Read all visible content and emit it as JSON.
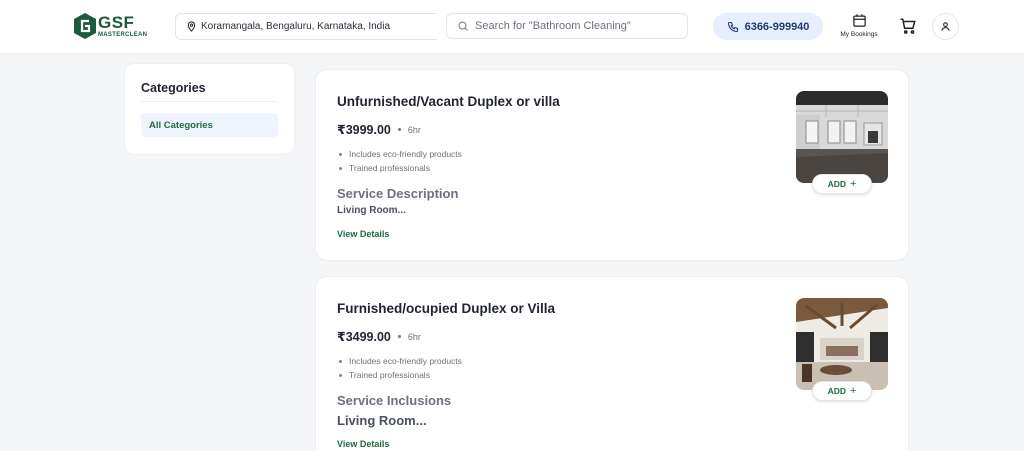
{
  "header": {
    "logo": {
      "big": "GSF",
      "small": "MASTERCLEAN"
    },
    "location": "Koramangala, Bengaluru, Karnataka, India",
    "search_placeholder": "Search for \"Bathroom Cleaning\"",
    "phone": "6366-999940",
    "bookings_label": "My Bookings",
    "icons": [
      "location-pin-icon",
      "search-icon",
      "phone-icon",
      "calendar-icon",
      "cart-icon",
      "user-icon"
    ]
  },
  "sidebar": {
    "title": "Categories",
    "items": [
      {
        "label": "All Categories"
      }
    ]
  },
  "services": [
    {
      "title": "Unfurnished/Vacant Duplex or villa",
      "price": "₹3999.00",
      "duration": "6hr",
      "features": [
        "Includes eco-friendly products",
        "Trained professionals"
      ],
      "desc_title": "Service Description",
      "desc_sub": "Living Room...",
      "view_label": "View Details",
      "add_label": "ADD",
      "add_plus": "+"
    },
    {
      "title": "Furnished/ocupied Duplex or Villa",
      "price": "₹3499.00",
      "duration": "6hr",
      "features": [
        "Includes eco-friendly products",
        "Trained professionals"
      ],
      "desc_title": "Service Inclusions",
      "desc_sub": "Living Room...",
      "view_label": "View Details",
      "add_label": "ADD",
      "add_plus": "+"
    }
  ],
  "colors": {
    "brand_green": "#1e5a3a",
    "accent_green": "#1e6a45",
    "phone_bg": "#e6efff",
    "page_bg": "#f4f5f7"
  }
}
